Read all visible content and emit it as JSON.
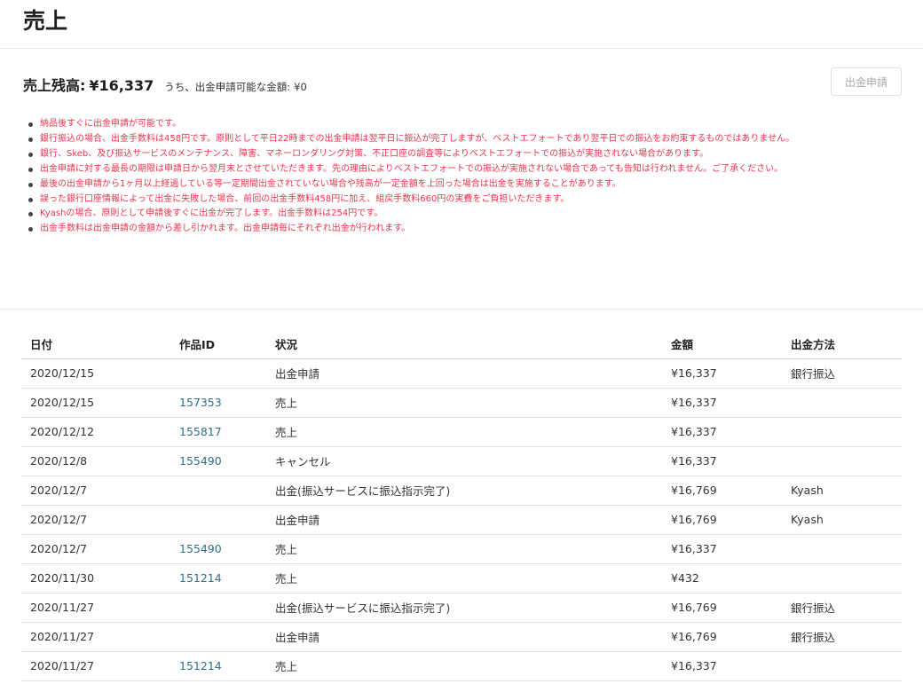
{
  "page": {
    "title": "売上"
  },
  "balance": {
    "label": "売上残高:",
    "value": "¥16,337",
    "withdrawable_label": "うち、出金申請可能な金額:",
    "withdrawable_value": "¥0",
    "button_label": "出金申請"
  },
  "notes": [
    "納品後すぐに出金申請が可能です。",
    "銀行振込の場合、出金手数料は458円です。原則として平日22時までの出金申請は翌平日に振込が完了しますが、ベストエフォートであり翌平日での振込をお約束するものではありません。",
    "銀行、Skeb、及び振込サービスのメンテナンス、障害、マネーロンダリング対策、不正口座の調査等によりベストエフォートでの振込が実施されない場合があります。",
    "出金申請に対する最長の期限は申請日から翌月末とさせていただきます。先の理由によりベストエフォートでの振込が実施されない場合であっても告知は行われません。ご了承ください。",
    "最後の出金申請から1ヶ月以上経過している等一定期間出金されていない場合や残高が一定金額を上回った場合は出金を実施することがあります。",
    "誤った銀行口座情報によって出金に失敗した場合、前回の出金手数料458円に加え、組戻手数料660円の実費をご負担いただきます。",
    "Kyashの場合、原則として申請後すぐに出金が完了します。出金手数料は254円です。",
    "出金手数料は出金申請の金額から差し引かれます。出金申請毎にそれぞれ出金が行われます。"
  ],
  "table": {
    "headers": {
      "date": "日付",
      "work_id": "作品ID",
      "status": "状況",
      "amount": "金額",
      "method": "出金方法"
    },
    "rows": [
      {
        "date": "2020/12/15",
        "work_id": "",
        "status": "出金申請",
        "amount": "¥16,337",
        "method": "銀行振込"
      },
      {
        "date": "2020/12/15",
        "work_id": "157353",
        "status": "売上",
        "amount": "¥16,337",
        "method": ""
      },
      {
        "date": "2020/12/12",
        "work_id": "155817",
        "status": "売上",
        "amount": "¥16,337",
        "method": ""
      },
      {
        "date": "2020/12/8",
        "work_id": "155490",
        "status": "キャンセル",
        "amount": "¥16,337",
        "method": ""
      },
      {
        "date": "2020/12/7",
        "work_id": "",
        "status": "出金(振込サービスに振込指示完了)",
        "amount": "¥16,769",
        "method": "Kyash"
      },
      {
        "date": "2020/12/7",
        "work_id": "",
        "status": "出金申請",
        "amount": "¥16,769",
        "method": "Kyash"
      },
      {
        "date": "2020/12/7",
        "work_id": "155490",
        "status": "売上",
        "amount": "¥16,337",
        "method": ""
      },
      {
        "date": "2020/11/30",
        "work_id": "151214",
        "status": "売上",
        "amount": "¥432",
        "method": ""
      },
      {
        "date": "2020/11/27",
        "work_id": "",
        "status": "出金(振込サービスに振込指示完了)",
        "amount": "¥16,769",
        "method": "銀行振込"
      },
      {
        "date": "2020/11/27",
        "work_id": "",
        "status": "出金申請",
        "amount": "¥16,769",
        "method": "銀行振込"
      },
      {
        "date": "2020/11/27",
        "work_id": "151214",
        "status": "売上",
        "amount": "¥16,337",
        "method": ""
      }
    ]
  },
  "colors": {
    "note_text": "#e8364d",
    "work_link": "#2f6f8b",
    "divider": "#ececec"
  }
}
